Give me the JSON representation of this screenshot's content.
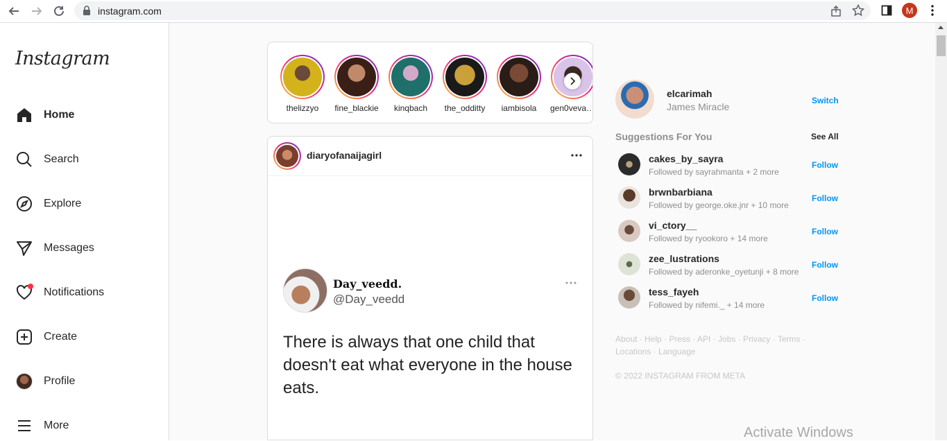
{
  "browser": {
    "url": "instagram.com",
    "profile_initial": "M"
  },
  "nav": {
    "logo": "Instagram",
    "items": [
      {
        "label": "Home",
        "icon": "home-icon"
      },
      {
        "label": "Search",
        "icon": "search-icon"
      },
      {
        "label": "Explore",
        "icon": "compass-icon"
      },
      {
        "label": "Messages",
        "icon": "send-icon"
      },
      {
        "label": "Notifications",
        "icon": "heart-icon"
      },
      {
        "label": "Create",
        "icon": "plus-square-icon"
      },
      {
        "label": "Profile",
        "icon": "avatar"
      },
      {
        "label": "More",
        "icon": "hamburger-icon"
      }
    ]
  },
  "stories": [
    {
      "name": "thelizzyo",
      "color": "#d4b21c"
    },
    {
      "name": "fine_blackie",
      "color": "#6b3a2a"
    },
    {
      "name": "kinqbach",
      "color": "#1f6f6a"
    },
    {
      "name": "the_odditty",
      "color": "#1a1a1a"
    },
    {
      "name": "iambisola",
      "color": "#3a2a24"
    },
    {
      "name": "gen0vevau...",
      "color": "#d9c3e8"
    }
  ],
  "post": {
    "username": "diaryofanaijagirl",
    "tweet": {
      "name": "Day_veedd.",
      "handle": "@Day_veedd",
      "text": "There is always that one child that doesn't eat what everyone in the house eats."
    }
  },
  "sidebar": {
    "me": {
      "username": "elcarimah",
      "name": "James Miracle",
      "switch_label": "Switch"
    },
    "suggestions_title": "Suggestions For You",
    "see_all": "See All",
    "suggestions": [
      {
        "username": "cakes_by_sayra",
        "sub": "Followed by sayrahmanta + 2 more",
        "action": "Follow",
        "color": "#2b2b2b"
      },
      {
        "username": "brwnbarbiana",
        "sub": "Followed by george.oke.jnr + 10 more",
        "action": "Follow",
        "color": "#5a3a2a"
      },
      {
        "username": "vi_ctory__",
        "sub": "Followed by ryookoro + 14 more",
        "action": "Follow",
        "color": "#d9c9c1"
      },
      {
        "username": "zee_lustrations",
        "sub": "Followed by aderonke_oyetunji + 8 more",
        "action": "Follow",
        "color": "#dfe3d6"
      },
      {
        "username": "tess_fayeh",
        "sub": "Followed by nifemi._ + 14 more",
        "action": "Follow",
        "color": "#6b4a3a"
      }
    ],
    "footer_links": "About · Help · Press · API · Jobs · Privacy · Terms · Locations · Language",
    "copyright": "© 2022 INSTAGRAM FROM META"
  },
  "os": {
    "watermark": "Activate Windows"
  },
  "colors": {
    "accent_blue": "#0095f6",
    "notification_dot": "#ff3040"
  }
}
